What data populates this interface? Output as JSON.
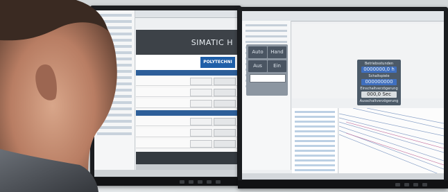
{
  "left_screen": {
    "hmi_title": "SIMATIC H",
    "logo_text": "POLYTECHNI"
  },
  "right_screen": {
    "faceplate": {
      "buttons": [
        "Auto",
        "Hand",
        "Aus",
        "Ein"
      ]
    },
    "gauge": {
      "label_1": "Betriebsstunden",
      "value_1": "0000000,0 h",
      "label_2": "Schaltspiele",
      "value_2": "000000000",
      "label_3": "Einschaltverzögerung",
      "value_3": "000,0 Sec",
      "label_4": "Ausschaltverzögerung"
    }
  },
  "colors": {
    "monitor_bezel": "#1b1d20",
    "hmi_header": "#3d4248",
    "table_header": "#2d5e99",
    "faceplate": "#8c96a1",
    "gauge_panel": "#4c5a68",
    "gauge_value": "#3f6fbf"
  }
}
